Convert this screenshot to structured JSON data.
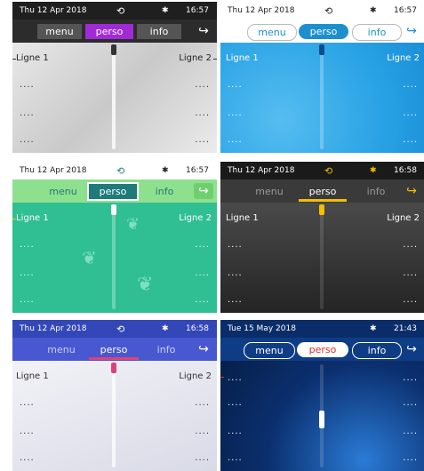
{
  "panels": [
    {
      "date": "Thu 12 Apr 2018",
      "time": "16:57",
      "tabs": {
        "menu": "menu",
        "perso": "perso",
        "info": "info"
      },
      "line1": "Ligne 1",
      "line2": "Ligne 2",
      "dots": "....",
      "colors": {
        "status_bg": "#1f1f1f",
        "tab_bg": "#2c2c2c",
        "accent": "#a02bd6",
        "content": "#d7d7d7"
      }
    },
    {
      "date": "Thu 12 Apr 2018",
      "time": "16:57",
      "tabs": {
        "menu": "menu",
        "perso": "perso",
        "info": "info"
      },
      "line1": "Ligne 1",
      "line2": "Ligne 2",
      "dots": "....",
      "colors": {
        "status_bg": "#ffffff",
        "tab_bg": "#ffffff",
        "accent": "#1c8fcf",
        "content": "#2aa3e6"
      }
    },
    {
      "date": "Thu 12 Apr 2018",
      "time": "16:57",
      "tabs": {
        "menu": "menu",
        "perso": "perso",
        "info": "info"
      },
      "line1": "Ligne 1",
      "line2": "Ligne 2",
      "dots": "....",
      "colors": {
        "status_bg": "#ffffff",
        "tab_bg": "#8ee08e",
        "accent": "#1f7a7a",
        "content": "#2fbf93"
      }
    },
    {
      "date": "Thu 12 Apr 2018",
      "time": "16:58",
      "tabs": {
        "menu": "menu",
        "perso": "perso",
        "info": "info"
      },
      "line1": "Ligne 1",
      "line2": "Ligne 2",
      "dots": "....",
      "colors": {
        "status_bg": "#1a1a1a",
        "tab_bg": "#3a3a3a",
        "accent": "#f2c000",
        "content": "#2e2e2e"
      }
    },
    {
      "date": "Thu 12 Apr 2018",
      "time": "16:58",
      "tabs": {
        "menu": "menu",
        "perso": "perso",
        "info": "info"
      },
      "line1": "Ligne 1",
      "line2": "Ligne 2",
      "dots": "....",
      "colors": {
        "status_bg": "#3347b8",
        "tab_bg": "#4858d0",
        "accent": "#e0407a",
        "content": "#e6e6ef"
      }
    },
    {
      "date": "Tue 15 May 2018",
      "time": "21:43",
      "tabs": {
        "menu": "menu",
        "perso": "perso",
        "info": "info"
      },
      "dots": "....",
      "colors": {
        "status_bg": "#0a2d6a",
        "tab_bg": "#0f3d85",
        "accent": "#d93030",
        "content": "#0b2f6e"
      }
    }
  ]
}
